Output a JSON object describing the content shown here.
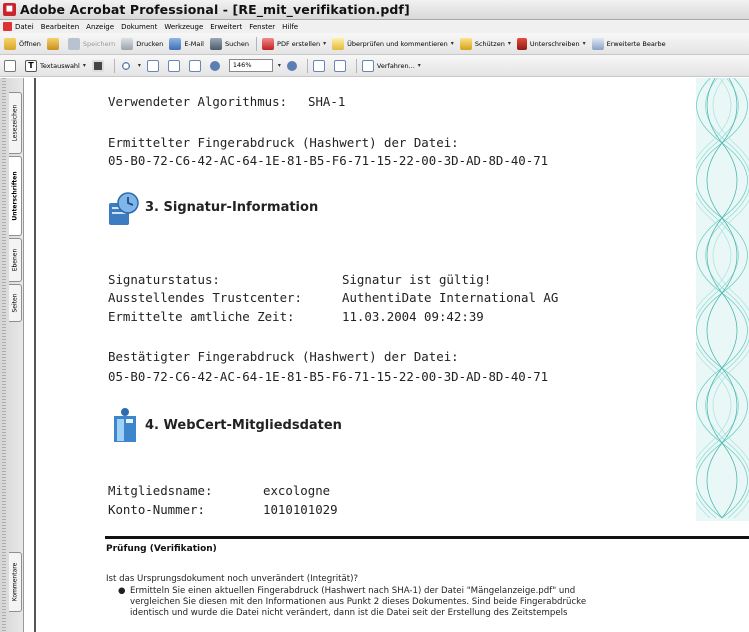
{
  "window": {
    "title": "Adobe Acrobat Professional - [RE_mit_verifikation.pdf]"
  },
  "menu": [
    "Datei",
    "Bearbeiten",
    "Anzeige",
    "Dokument",
    "Werkzeuge",
    "Erweitert",
    "Fenster",
    "Hilfe"
  ],
  "toolbar1": {
    "open": "Öffnen",
    "save": "Speichern",
    "print": "Drucken",
    "email": "E-Mail",
    "search": "Suchen",
    "create_pdf": "PDF erstellen",
    "review": "Überprüfen und kommentieren",
    "protect": "Schützen",
    "sign": "Unterschreiben",
    "advanced": "Erweiterte Bearbe"
  },
  "toolbar2": {
    "text_select": "Textauswahl",
    "zoom": "146%",
    "procedures": "Verfahren..."
  },
  "sidepane": {
    "tabs": [
      "Lesezeichen",
      "Unterschriften",
      "Ebenen",
      "Seiten",
      "Kommentare"
    ]
  },
  "doc": {
    "algorithm_label": "Verwendeter Algorithmus:",
    "algorithm_value": "SHA-1",
    "fp_file_label": "Ermittelter Fingerabdruck (Hashwert) der Datei:",
    "fp_file_value": "05-B0-72-C6-42-AC-64-1E-81-B5-F6-71-15-22-00-3D-AD-8D-40-71",
    "sec3_title": "3.  Signatur-Information",
    "sig_status_label": "Signaturstatus:",
    "sig_status_value": "Signatur ist gültig!",
    "trustcenter_label": "Ausstellendes Trustcenter:",
    "trustcenter_value": "AuthentiDate International AG",
    "time_label": "Ermittelte amtliche Zeit:",
    "time_value": "11.03.2004 09:42:39",
    "fp_confirmed_label": "Bestätigter Fingerabdruck (Hashwert) der Datei:",
    "fp_confirmed_value": "05-B0-72-C6-42-AC-64-1E-81-B5-F6-71-15-22-00-3D-AD-8D-40-71",
    "sec4_title": "4.  WebCert-Mitgliedsdaten",
    "member_label": "Mitgliedsname:",
    "member_value": "excologne",
    "account_label": "Konto-Nummer:",
    "account_value": "1010101029",
    "check_heading": "Prüfung (Verifikation)",
    "check_question": "Ist das Ursprungsdokument noch unverändert (Integrität)?",
    "bullet_line1": "Ermitteln Sie einen aktuellen Fingerabdruck (Hashwert nach SHA-1) der Datei \"Mängelanzeige.pdf\" und",
    "bullet_line2": "vergleichen Sie diesen mit den Informationen aus Punkt 2 dieses Dokumentes. Sind beide Fingerabdrücke",
    "bullet_line3": "identisch und wurde die Datei nicht verändert, dann ist die Datei seit der Erstellung des Zeitstempels"
  }
}
